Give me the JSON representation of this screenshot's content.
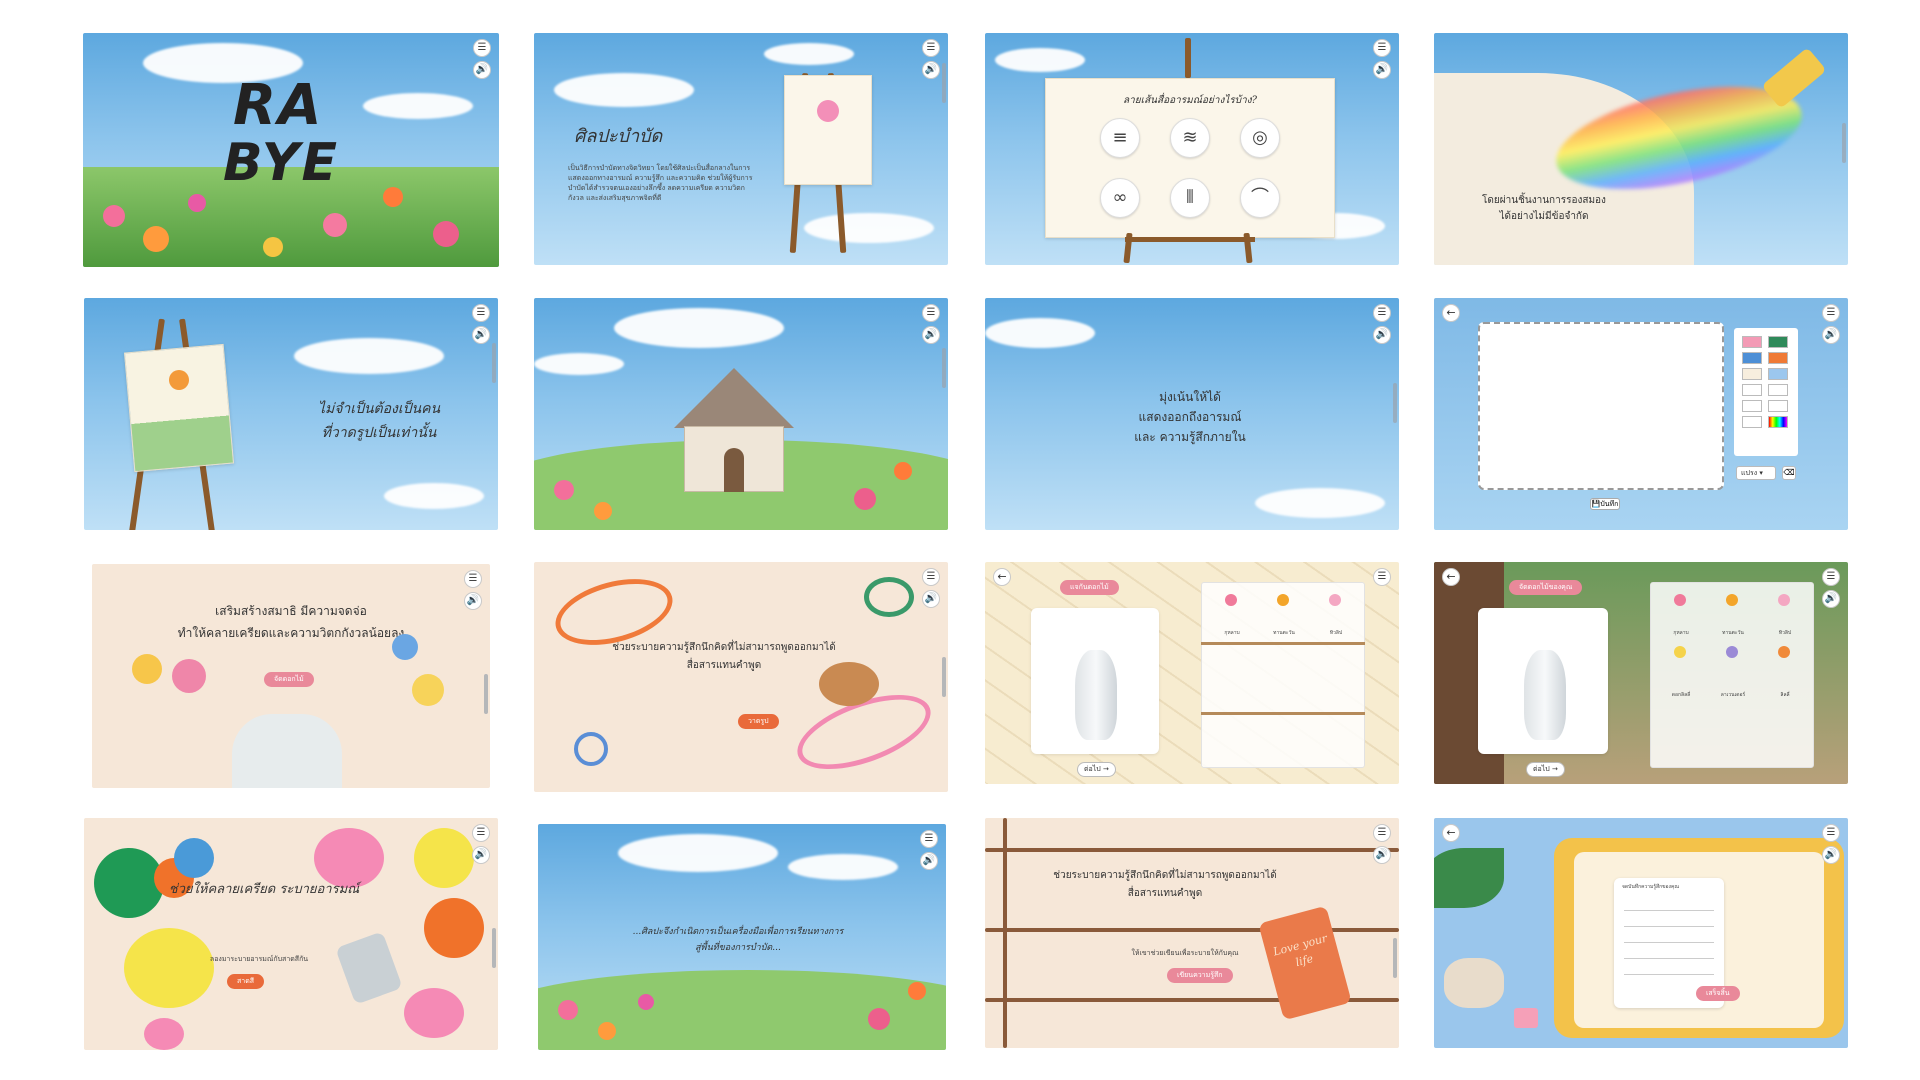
{
  "ui": {
    "menu_icon": "☰",
    "sound_icon": "🔊",
    "back_icon": "←"
  },
  "slides": {
    "s1": {
      "logo_line1": "RA",
      "logo_line2": "BYE"
    },
    "s2": {
      "title": "ศิลปะบำบัด",
      "body": "เป็นวิธีการบำบัดทางจิตวิทยา โดยใช้ศิลปะเป็นสื่อกลางในการแสดงออกทางอารมณ์ ความรู้สึก และความคิด ช่วยให้ผู้รับการบำบัดได้สำรวจตนเองอย่างลึกซึ้ง ลดความเครียด ความวิตกกังวล และส่งเสริมสุขภาพจิตที่ดี"
    },
    "s3": {
      "title": "ลายเส้นสื่ออารมณ์อย่างไรบ้าง?"
    },
    "s4": {
      "line1": "โดยผ่านชิ้นงานการรองสมอง",
      "line2": "ได้อย่างไม่มีข้อจำกัด"
    },
    "s5": {
      "line1": "ไม่จำเป็นต้องเป็นคน",
      "line2": "ที่วาดรูปเป็นเท่านั้น"
    },
    "s7": {
      "line1": "มุ่งเน้นให้ได้",
      "line2": "แสดงออกถึงอารมณ์",
      "line3": "และ ความรู้สึกภายใน"
    },
    "s8": {
      "tool_select": "แปรง",
      "save_label": "บันทึก"
    },
    "s9": {
      "line1": "เสริมสร้างสมาธิ มีความจดจ่อ",
      "line2": "ทำให้คลายเครียดและความวิตกกังวลน้อยลง",
      "button": "จัดดอกไม้"
    },
    "s10": {
      "line1": "ช่วยระบายความรู้สึกนึกคิดที่ไม่สามารถพูดออกมาได้",
      "line2": "สื่อสารแทนคำพูด",
      "button": "วาดรูป"
    },
    "s11": {
      "tag": "แจกันดอกไม้",
      "flowers": [
        "กุหลาบ",
        "ทานตะวัน",
        "ทิวลิป"
      ],
      "next": "ต่อไป →"
    },
    "s12": {
      "tag": "จัดดอกไม้ของคุณ",
      "flowers": [
        "กุหลาบ",
        "ทานตะวัน",
        "ทิวลิป",
        "ดอกลิลลี่",
        "ลาเวนเดอร์",
        "ลิลลี่"
      ],
      "next": "ต่อไป →"
    },
    "s13": {
      "title": "ช่วยให้คลายเครียด ระบายอารมณ์",
      "caption": "ลองมาระบายอารมณ์กับสาดสีกัน",
      "button": "สาดสี"
    },
    "s14": {
      "line1": "...ศิลปะจึงกำเนิดการเป็นเครื่องมือเพื่อการเรียนทางการ",
      "line2": "สู่พื้นที่ของการบำบัด..."
    },
    "s15": {
      "line1": "ช่วยระบายความรู้สึกนึกคิดที่ไม่สามารถพูดออกมาได้",
      "line2": "สื่อสารแทนคำพูด",
      "caption": "ให้เขาช่วยเขียนเพื่อระบายให้กับคุณ",
      "button": "เขียนความรู้สึก",
      "notebook_text": "Love your life"
    },
    "s16": {
      "note_title": "จดบันทึกความรู้สึกของคุณ",
      "button": "เสร็จสิ้น"
    }
  }
}
